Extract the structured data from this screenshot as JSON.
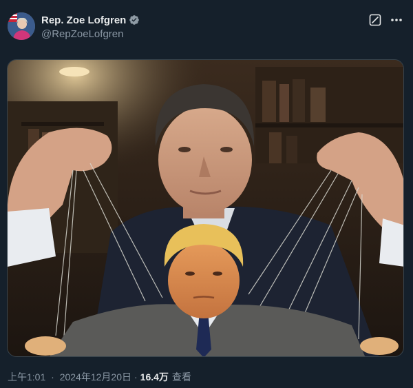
{
  "author": {
    "display_name": "Rep. Zoe Lofgren",
    "handle": "@RepZoeLofgren",
    "verified_icon": "verified-badge-icon",
    "avatar_alt": "avatar"
  },
  "header_actions": {
    "grok_icon": "grok-icon",
    "more_icon": "more-options-icon"
  },
  "media": {
    "type": "image",
    "description_icon": "photo"
  },
  "footer": {
    "time": "上午1:01",
    "separator": "·",
    "date": "2024年12月20日",
    "views_count": "16.4万",
    "views_label": "查看"
  },
  "colors": {
    "background": "#15202b",
    "text_primary": "#e7e9ea",
    "text_secondary": "#8b98a5",
    "verified": "#e7e9ea",
    "border": "#38444d"
  }
}
